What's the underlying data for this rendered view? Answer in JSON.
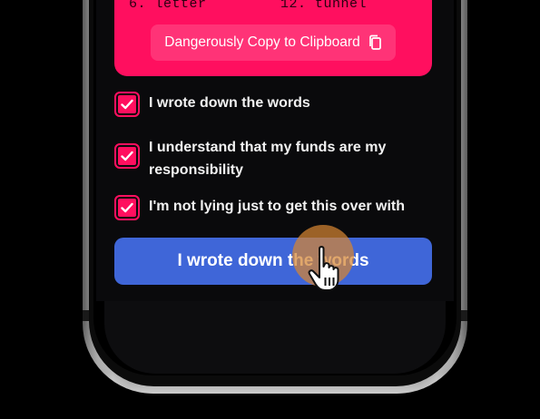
{
  "seed_words": {
    "left": "6. letter",
    "right": "12. tunnel"
  },
  "copy_button": {
    "label": "Dangerously Copy to Clipboard",
    "icon": "copy-icon"
  },
  "checklist": [
    {
      "label": "I wrote down the words",
      "checked": true
    },
    {
      "label": "I understand that my funds are my responsibility",
      "checked": true
    },
    {
      "label": "I'm not lying just to get this over with",
      "checked": true
    }
  ],
  "primary_button": {
    "label": "I wrote down the words"
  },
  "colors": {
    "seed_card": "#ff0f5f",
    "copy_button": "#ff3377",
    "primary_button": "#3f66d8",
    "tap_indicator": "#d68532"
  }
}
